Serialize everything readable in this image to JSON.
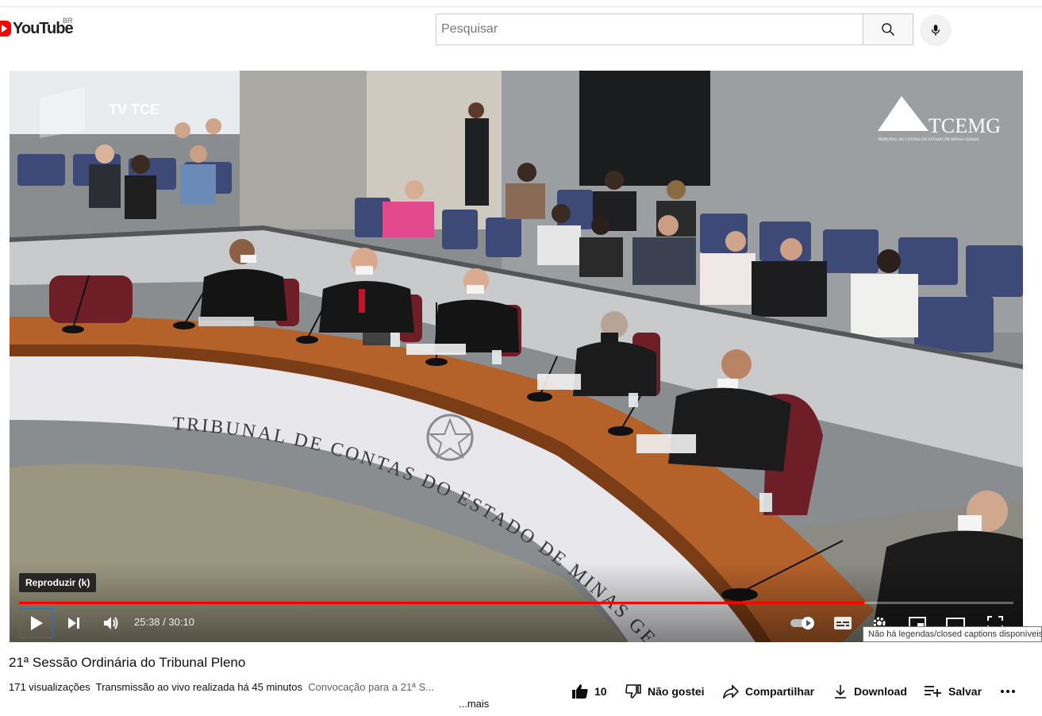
{
  "header": {
    "logo_text": "YouTube",
    "country_code": "BR",
    "search_placeholder": "Pesquisar",
    "search_icon": "search-icon",
    "mic_icon": "mic-icon"
  },
  "video": {
    "channel_overlay_left": "TV TCE",
    "channel_overlay_right": "TCEMG",
    "channel_overlay_right_sub": "TRIBUNAL DE CONTAS DO ESTADO DE MINAS GERAIS",
    "bench_inscription": "TRIBUNAL DE CONTAS DO ESTADO DE MINAS GERAIS",
    "tooltip": "Reproduzir (k)",
    "current_time": "25:38",
    "duration": "30:10",
    "time_display": "25:38 / 30:10",
    "progress_fraction": 0.85,
    "captions_tooltip": "Não há legendas/closed captions disponíveis",
    "accent_color": "#ff0000"
  },
  "info": {
    "title": "21ª Sessão Ordinária do Tribunal Pleno",
    "views": "171 visualizações",
    "live_info": "Transmissão ao vivo realizada há 45 minutos",
    "description_snippet": "Convocação para a 21ª S...",
    "more_label": "...mais"
  },
  "actions": {
    "like_count": "10",
    "dislike_label": "Não gostei",
    "share_label": "Compartilhar",
    "download_label": "Download",
    "save_label": "Salvar",
    "more_icon": "more-horiz-icon"
  }
}
